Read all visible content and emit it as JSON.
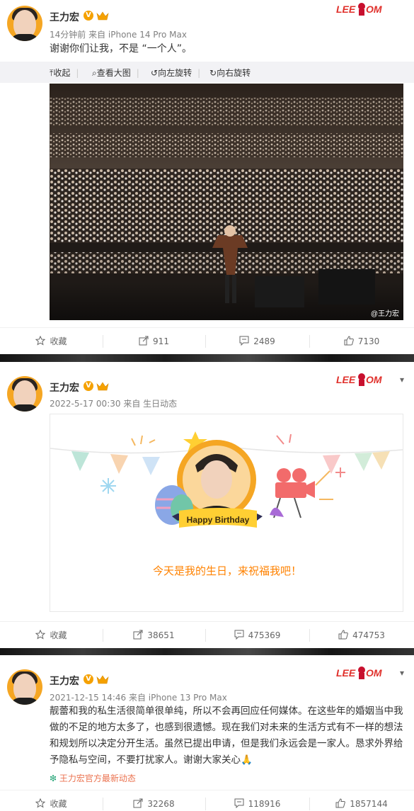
{
  "posts": [
    {
      "user": "王力宏",
      "meta": "14分钟前 来自 iPhone 14 Pro Max",
      "text": "谢谢你们让我，不是 “一个人”。",
      "image_toolbar": [
        "收起",
        "查看大图",
        "向左旋转",
        "向右旋转"
      ],
      "watermark": "@王力宏",
      "actions": {
        "fav": "收藏",
        "share": "911",
        "comment": "2489",
        "like": "7130"
      }
    },
    {
      "user": "王力宏",
      "meta": "2022-5-17 00:30 来自 生日动态",
      "card_banner": "Happy Birthday",
      "card_text": "今天是我的生日，来祝福我吧！",
      "actions": {
        "fav": "收藏",
        "share": "38651",
        "comment": "475369",
        "like": "474753"
      }
    },
    {
      "user": "王力宏",
      "meta": "2021-12-15 14:46 来自 iPhone 13 Pro Max",
      "text": "靓蕾和我的私生活很简单很单纯，所以不会再回应任何媒体。在这些年的婚姻当中我做的不足的地方太多了，也感到很遗憾。现在我们对未来的生活方式有不一样的想法和规划所以决定分开生活。虽然已提出申请，但是我们永远会是一家人。恳求外界给予隐私与空间，不要打扰家人。谢谢大家关心🙏",
      "link": "王力宏官方最新动态",
      "actions": {
        "fav": "收藏",
        "share": "32268",
        "comment": "118916",
        "like": "1857144"
      }
    }
  ],
  "colors": {
    "accent": "#ff8200",
    "link": "#eb7350",
    "verified": "#f5a100"
  }
}
